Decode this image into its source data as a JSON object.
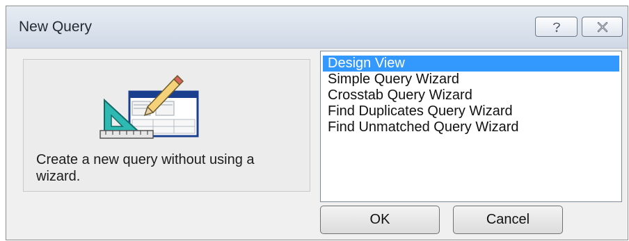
{
  "dialog": {
    "title": "New Query",
    "help_button_icon": "question-icon",
    "close_button_icon": "close-icon"
  },
  "left_panel": {
    "illustration_icon": "query-design-icon",
    "description": "Create a new query without using a wizard."
  },
  "list": {
    "items": [
      "Design View",
      "Simple Query Wizard",
      "Crosstab Query Wizard",
      "Find Duplicates Query Wizard",
      "Find Unmatched Query Wizard"
    ],
    "selected_index": 0
  },
  "buttons": {
    "ok_label": "OK",
    "cancel_label": "Cancel"
  },
  "colors": {
    "selection": "#3399ff",
    "titlebar": "#dbe2ec",
    "panel": "#f0f0f0"
  }
}
